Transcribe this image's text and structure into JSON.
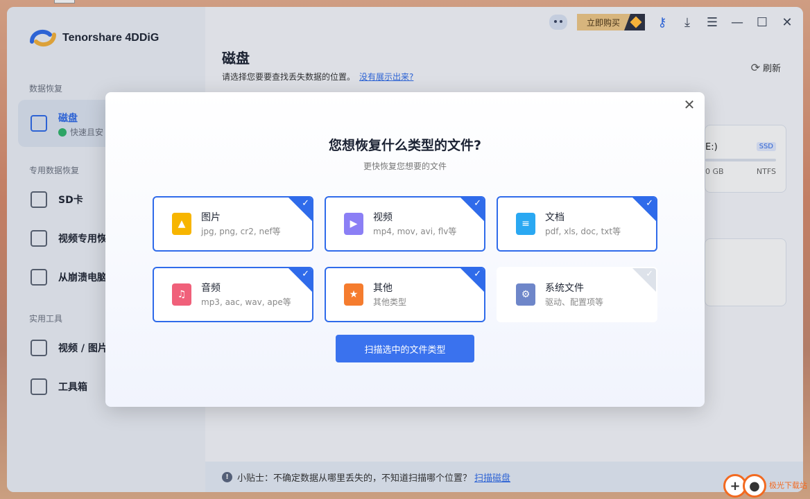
{
  "app": {
    "name": "Tenorshare 4DDiG",
    "buy_label": "立即购买"
  },
  "sidebar": {
    "section_recover": "数据恢复",
    "section_special": "专用数据恢复",
    "section_tools": "实用工具",
    "items": [
      {
        "label": "磁盘",
        "sub": "快速且安"
      },
      {
        "label": "SD卡"
      },
      {
        "label": "视频专用恢"
      },
      {
        "label": "从崩溃电脑"
      },
      {
        "label": "视频 / 图片"
      },
      {
        "label": "工具箱"
      }
    ]
  },
  "main": {
    "title": "磁盘",
    "desc": "请选择您要要查找丢失数据的位置。",
    "desc_link": "没有展示出来?",
    "refresh": "刷新",
    "disk": {
      "name": "E:)",
      "badge": "SSD",
      "capacity": "0 GB",
      "fs": "NTFS"
    },
    "disk2_label": " "
  },
  "tip": {
    "text": "小贴士：不确定数据从哪里丢失的，不知道扫描哪个位置？",
    "link": "扫描磁盘"
  },
  "dialog": {
    "title": "您想恢复什么类型的文件?",
    "subtitle": "更快恢复您想要的文件",
    "types": [
      {
        "name": "图片",
        "ext": "jpg, png, cr2, nef等",
        "checked": true,
        "icon": "image-icon",
        "color": "#f7b500"
      },
      {
        "name": "视频",
        "ext": "mp4, mov, avi, flv等",
        "checked": true,
        "icon": "video-icon",
        "color": "#8b7ff5"
      },
      {
        "name": "文档",
        "ext": "pdf, xls, doc, txt等",
        "checked": true,
        "icon": "document-icon",
        "color": "#2aa8f2"
      },
      {
        "name": "音频",
        "ext": "mp3, aac, wav, ape等",
        "checked": true,
        "icon": "audio-icon",
        "color": "#f0607a"
      },
      {
        "name": "其他",
        "ext": "其他类型",
        "checked": true,
        "icon": "star-icon",
        "color": "#f57c2e"
      },
      {
        "name": "系统文件",
        "ext": "驱动、配置项等",
        "checked": false,
        "icon": "gear-icon",
        "color": "#6e86c9"
      }
    ],
    "scan_button": "扫描选中的文件类型"
  },
  "watermark": {
    "text": "极光下载站"
  }
}
